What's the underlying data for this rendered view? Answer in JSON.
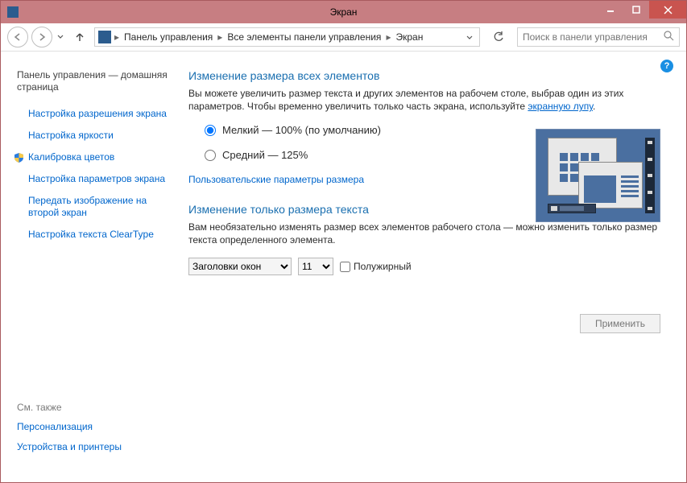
{
  "window_title": "Экран",
  "breadcrumb": {
    "items": [
      "Панель управления",
      "Все элементы панели управления",
      "Экран"
    ]
  },
  "search": {
    "placeholder": "Поиск в панели управления"
  },
  "sidebar": {
    "home": "Панель управления — домашняя страница",
    "items": [
      "Настройка разрешения экрана",
      "Настройка яркости",
      "Калибровка цветов",
      "Настройка параметров экрана",
      "Передать изображение на второй экран",
      "Настройка текста ClearType"
    ],
    "see_also_header": "См. также",
    "see_also": [
      "Персонализация",
      "Устройства и принтеры"
    ]
  },
  "main": {
    "section1_title": "Изменение размера всех элементов",
    "desc_prefix": "Вы можете увеличить размер текста и других элементов на рабочем столе, выбрав один из этих параметров. Чтобы временно увеличить только часть экрана, используйте ",
    "magnifier_link": "экранную лупу",
    "desc_suffix": ".",
    "radio_small": "Мелкий — 100% (по умолчанию)",
    "radio_medium": "Средний — 125%",
    "custom_link": "Пользовательские параметры размера",
    "section2_title": "Изменение только размера текста",
    "section2_desc": "Вам необязательно изменять размер всех элементов рабочего стола — можно изменить только размер текста определенного элемента.",
    "select_element": "Заголовки окон",
    "select_size": "11",
    "bold_label": "Полужирный",
    "apply": "Применить"
  }
}
